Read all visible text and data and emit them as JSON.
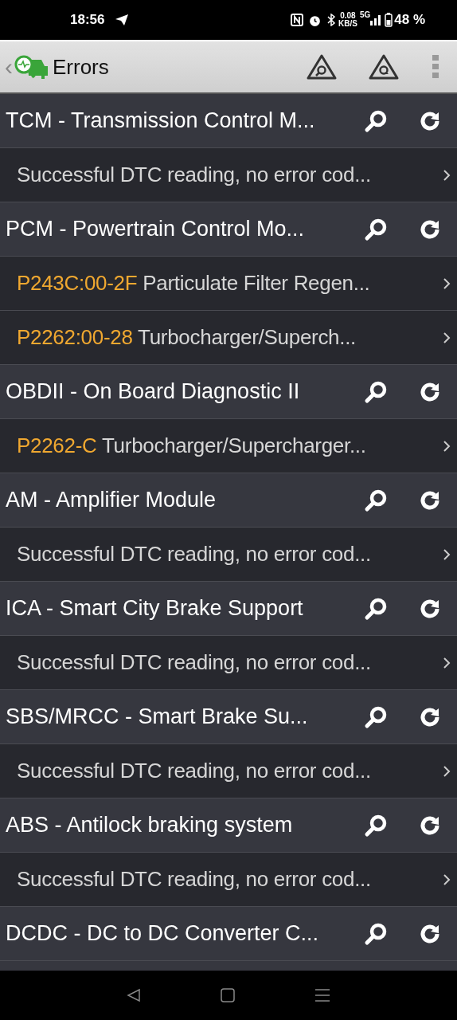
{
  "status_bar": {
    "time": "18:56",
    "speed": "0.08",
    "speed_unit": "KB/S",
    "network": "5G",
    "battery": "48 %"
  },
  "app_bar": {
    "back": "‹",
    "title": "Errors"
  },
  "rows": [
    {
      "kind": "module",
      "text": "TCM - Transmission Control M..."
    },
    {
      "kind": "result",
      "text": "Successful DTC reading, no error cod..."
    },
    {
      "kind": "module",
      "text": "PCM - Powertrain Control Mo..."
    },
    {
      "kind": "result",
      "code": "P243C:00-2F",
      "text": "Particulate Filter Regen..."
    },
    {
      "kind": "result",
      "code": "P2262:00-28",
      "text": "Turbocharger/Superch..."
    },
    {
      "kind": "module",
      "text": "OBDII - On Board Diagnostic II"
    },
    {
      "kind": "result",
      "code": "P2262-C",
      "text": "Turbocharger/Supercharger..."
    },
    {
      "kind": "module",
      "text": "AM - Amplifier Module"
    },
    {
      "kind": "result",
      "text": "Successful DTC reading, no error cod..."
    },
    {
      "kind": "module",
      "text": "ICA - Smart City Brake Support"
    },
    {
      "kind": "result",
      "text": "Successful DTC reading, no error cod..."
    },
    {
      "kind": "module",
      "text": "SBS/MRCC - Smart Brake Su..."
    },
    {
      "kind": "result",
      "text": "Successful DTC reading, no error cod..."
    },
    {
      "kind": "module",
      "text": "ABS - Antilock braking system"
    },
    {
      "kind": "result",
      "text": "Successful DTC reading, no error cod..."
    },
    {
      "kind": "module",
      "text": "DCDC - DC to DC Converter C..."
    }
  ]
}
